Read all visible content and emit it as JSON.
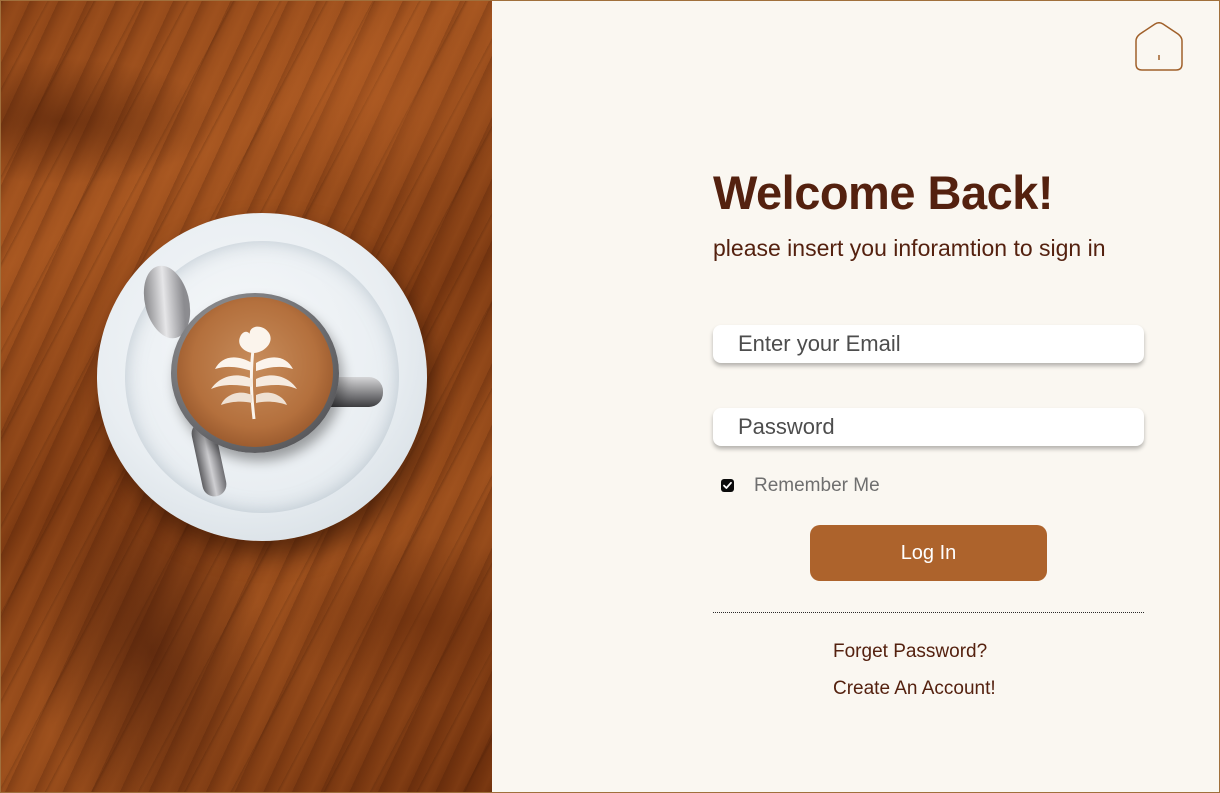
{
  "header": {
    "home_icon": "home-icon"
  },
  "form": {
    "title": "Welcome Back!",
    "subtitle": "please insert you inforamtion to sign in",
    "email_placeholder": "Enter your Email",
    "password_placeholder": "Password",
    "remember_label": "Remember Me",
    "remember_checked": true,
    "login_label": "Log In",
    "forgot_label": "Forget Password?",
    "create_label": "Create An Account!"
  },
  "colors": {
    "brand_dark": "#54210f",
    "button": "#ad632c",
    "background": "#faf7f1",
    "accent_border": "#a0703c"
  }
}
